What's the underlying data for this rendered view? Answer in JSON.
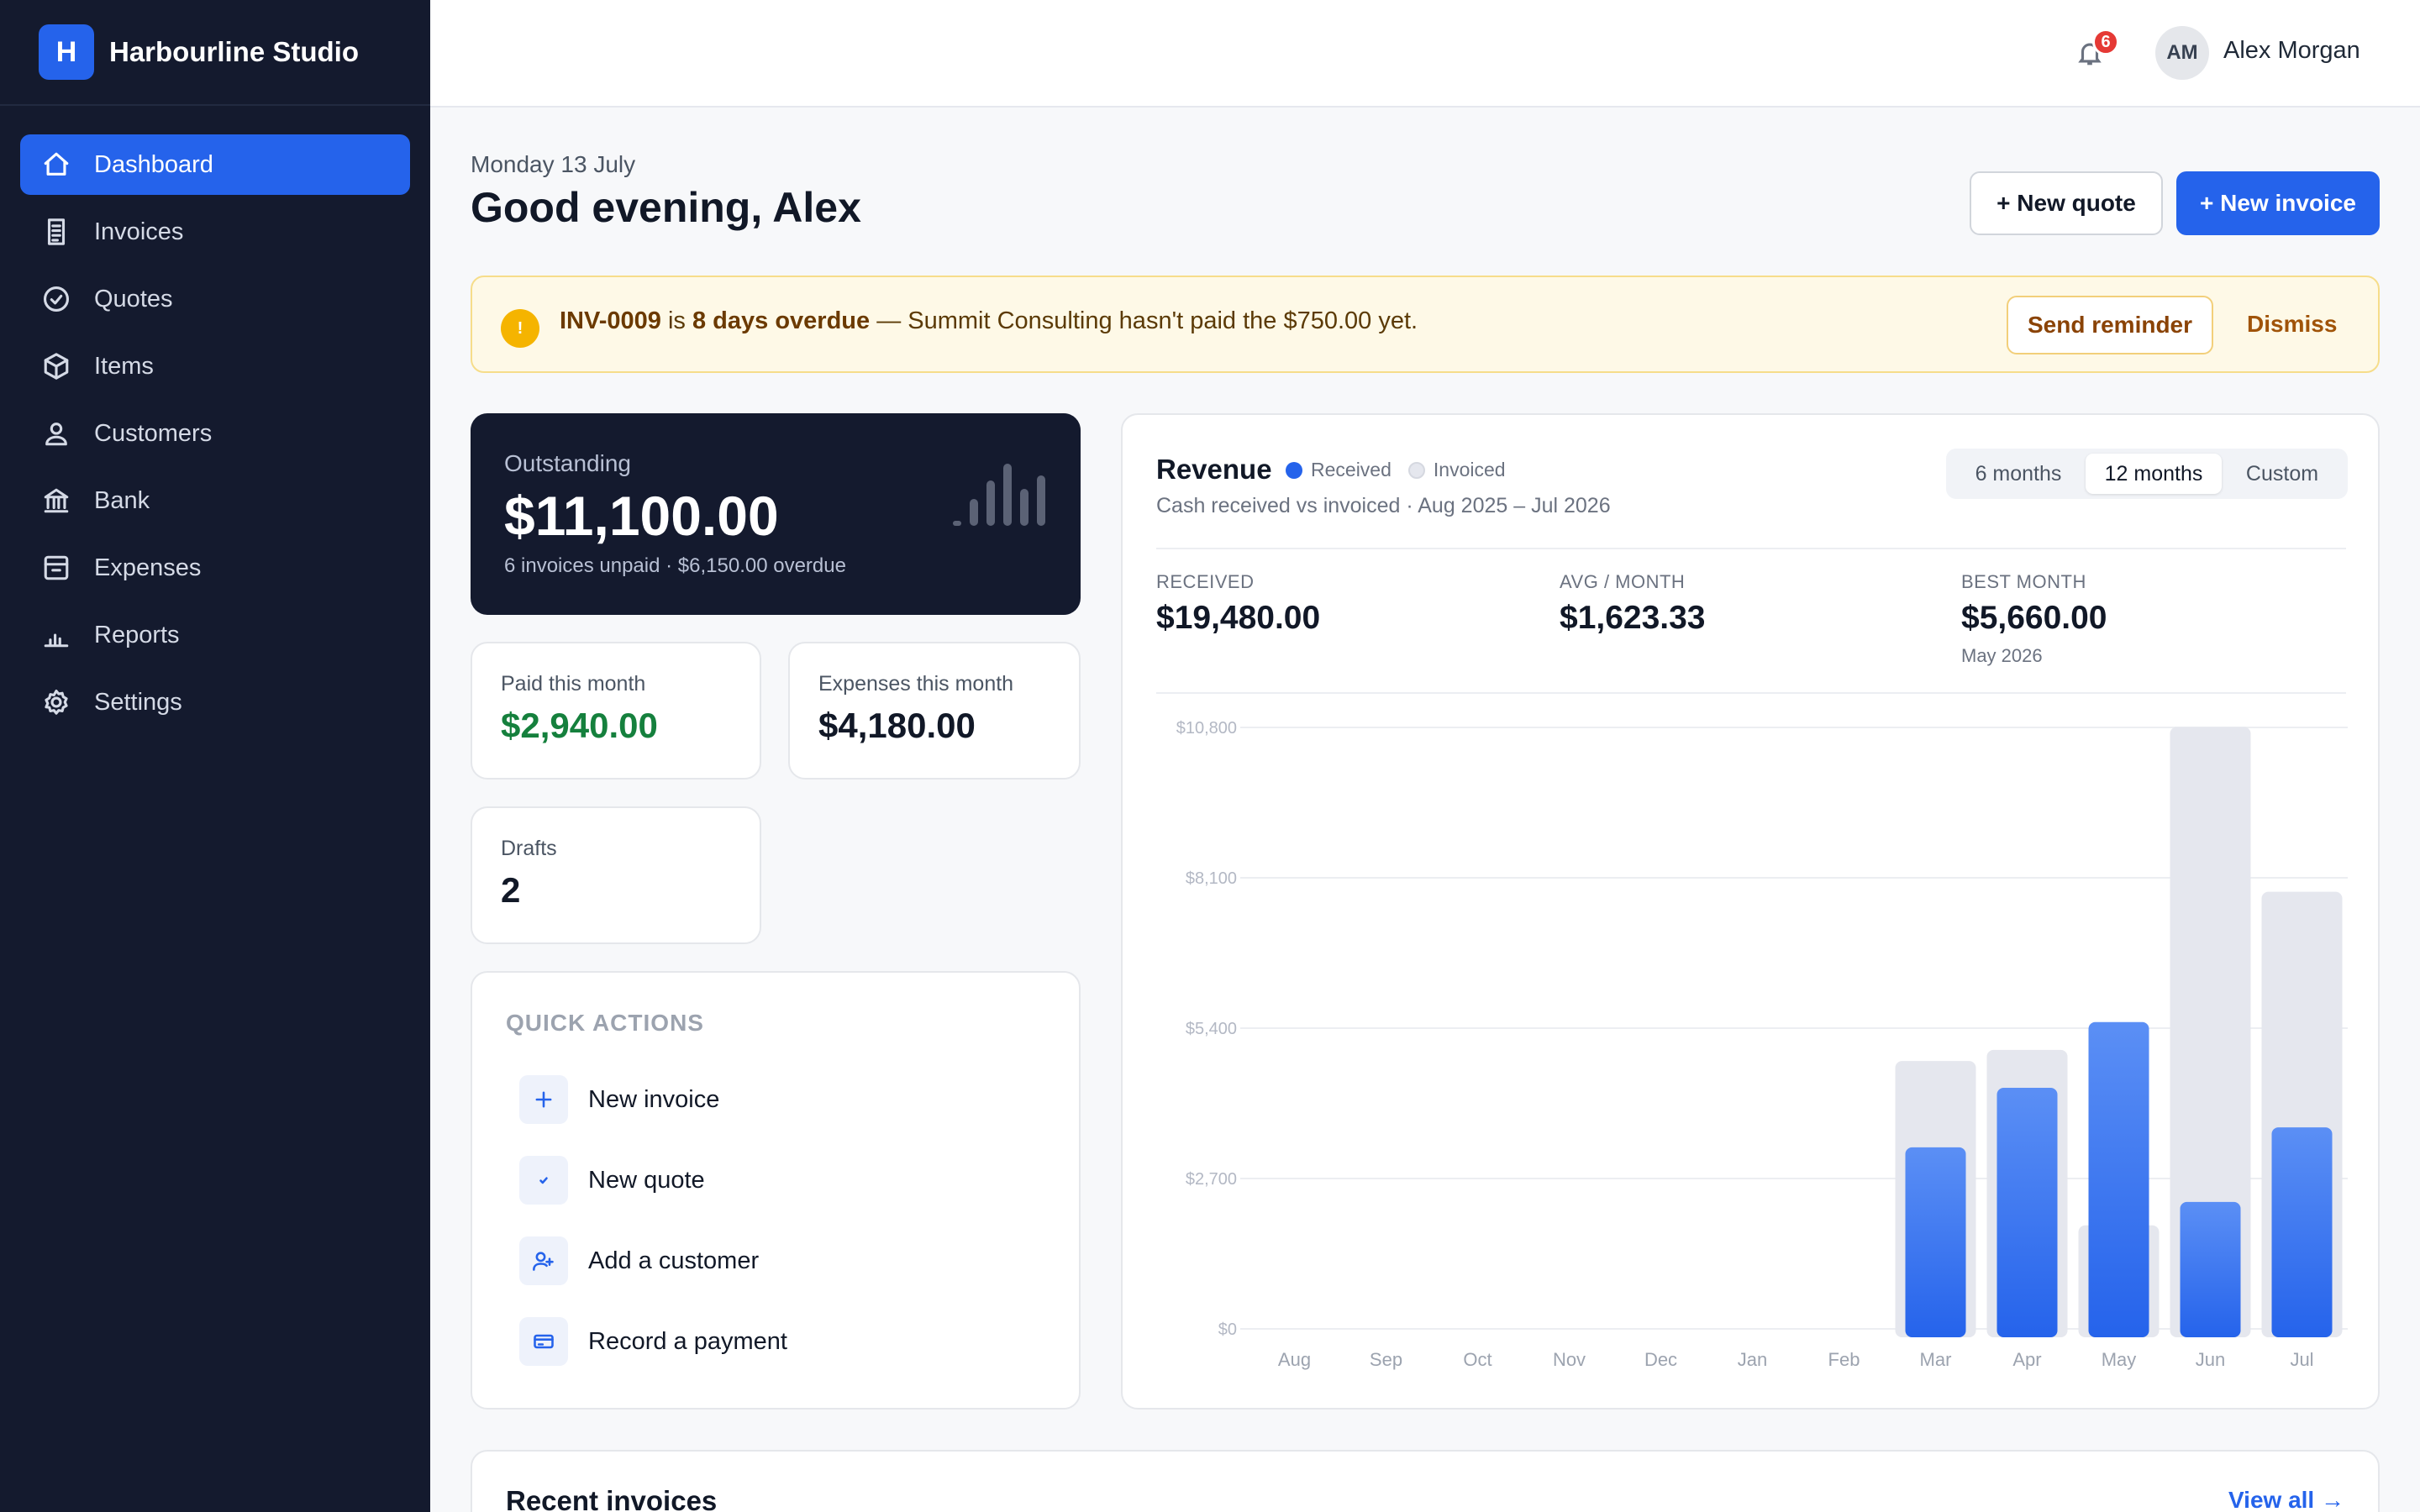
{
  "brand": {
    "logo_letter": "H",
    "name": "Harbourline Studio"
  },
  "sidebar": {
    "items": [
      {
        "label": "Dashboard",
        "icon": "home-icon",
        "active": true
      },
      {
        "label": "Invoices",
        "icon": "receipt-icon"
      },
      {
        "label": "Quotes",
        "icon": "check-circle-icon"
      },
      {
        "label": "Items",
        "icon": "box-icon"
      },
      {
        "label": "Customers",
        "icon": "user-icon"
      },
      {
        "label": "Bank",
        "icon": "bank-icon"
      },
      {
        "label": "Expenses",
        "icon": "wallet-icon"
      },
      {
        "label": "Reports",
        "icon": "bar-chart-icon"
      },
      {
        "label": "Settings",
        "icon": "gear-icon"
      }
    ]
  },
  "topbar": {
    "notification_count": "6",
    "avatar_initials": "AM",
    "user_name": "Alex Morgan"
  },
  "header": {
    "date": "Monday 13 July",
    "greeting": "Good evening, Alex",
    "new_quote_label": "+ New quote",
    "new_invoice_label": "+ New invoice"
  },
  "alert": {
    "icon": "!",
    "invoice_id": "INV-0009",
    "is_text": " is ",
    "overdue_text": "8 days overdue",
    "rest_text": " — Summit Consulting hasn't paid the $750.00 yet.",
    "remind_label": "Send reminder",
    "dismiss_label": "Dismiss"
  },
  "outstanding": {
    "label": "Outstanding",
    "value": "$11,100.00",
    "sub": "6 invoices unpaid · $6,150.00 overdue"
  },
  "stats": {
    "paid": {
      "label": "Paid this month",
      "value": "$2,940.00",
      "color": "#15803d"
    },
    "expenses": {
      "label": "Expenses this month",
      "value": "$4,180.00"
    },
    "drafts": {
      "label": "Drafts",
      "value": "2"
    }
  },
  "quick_actions": {
    "title": "QUICK ACTIONS",
    "items": [
      {
        "label": "New invoice",
        "icon": "plus-icon"
      },
      {
        "label": "New quote",
        "icon": "check-icon"
      },
      {
        "label": "Add a customer",
        "icon": "user-plus-icon"
      },
      {
        "label": "Record a payment",
        "icon": "card-icon"
      }
    ]
  },
  "revenue": {
    "title": "Revenue",
    "legend_received": "Received",
    "legend_invoiced": "Invoiced",
    "subtitle": "Cash received vs invoiced · Aug 2025 – Jul 2026",
    "ranges": [
      "6 months",
      "12 months",
      "Custom"
    ],
    "active_range": "12 months",
    "kpis": {
      "received": {
        "label": "RECEIVED",
        "value": "$19,480.00"
      },
      "avg": {
        "label": "AVG / MONTH",
        "value": "$1,623.33"
      },
      "best": {
        "label": "BEST MONTH",
        "value": "$5,660.00",
        "note": "May 2026"
      }
    }
  },
  "chart_data": {
    "type": "bar",
    "categories": [
      "Aug",
      "Sep",
      "Oct",
      "Nov",
      "Dec",
      "Jan",
      "Feb",
      "Mar",
      "Apr",
      "May",
      "Jun",
      "Jul"
    ],
    "series": [
      {
        "name": "Received",
        "values": [
          0,
          0,
          0,
          0,
          0,
          0,
          0,
          3410,
          4480,
          5660,
          2430,
          3770
        ],
        "color": "#2563eb"
      },
      {
        "name": "Invoiced",
        "values": [
          0,
          0,
          0,
          0,
          0,
          0,
          0,
          4960,
          5160,
          2010,
          10960,
          8000
        ],
        "color": "#e5e7ee"
      }
    ],
    "yticks": [
      "$10,800",
      "$8,100",
      "$5,400",
      "$2,700",
      "$0"
    ],
    "ylim": [
      0,
      10800
    ],
    "grid": true,
    "legend": "top-left"
  },
  "recent": {
    "title": "Recent invoices",
    "view_all": "View all →"
  },
  "colors": {
    "accent": "#2563eb",
    "sidebar": "#141a2e",
    "alert_bg": "#fef9e7"
  }
}
